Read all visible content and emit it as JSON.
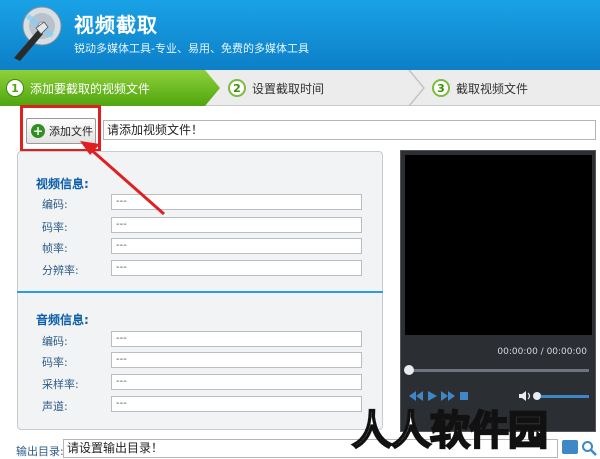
{
  "header": {
    "title": "视频截取",
    "subtitle": "锐动多媒体工具-专业、易用、免费的多媒体工具"
  },
  "steps": [
    {
      "num": "1",
      "label": "添加要截取的视频文件",
      "active": true
    },
    {
      "num": "2",
      "label": "设置截取时间",
      "active": false
    },
    {
      "num": "3",
      "label": "截取视频文件",
      "active": false
    }
  ],
  "add_file": {
    "button_label": "添加文件",
    "input_value": "请添加视频文件！"
  },
  "video_info": {
    "title": "视频信息:",
    "fields": [
      {
        "label": "编码:",
        "value": "---"
      },
      {
        "label": "码率:",
        "value": "---"
      },
      {
        "label": "帧率:",
        "value": "---"
      },
      {
        "label": "分辨率:",
        "value": "---"
      }
    ]
  },
  "audio_info": {
    "title": "音频信息:",
    "fields": [
      {
        "label": "编码:",
        "value": "---"
      },
      {
        "label": "码率:",
        "value": "---"
      },
      {
        "label": "采样率:",
        "value": "---"
      },
      {
        "label": "声道:",
        "value": "---"
      }
    ]
  },
  "player": {
    "time": "00:00:00 / 00:00:00",
    "progress": 0
  },
  "output": {
    "label": "输出目录:",
    "value": "请设置输出目录！"
  },
  "watermark": "人人软件园",
  "colors": {
    "header": "#1a96dc",
    "step_active": "#5fb01c",
    "annotation": "#e02020",
    "accent": "#2a9ee2"
  }
}
